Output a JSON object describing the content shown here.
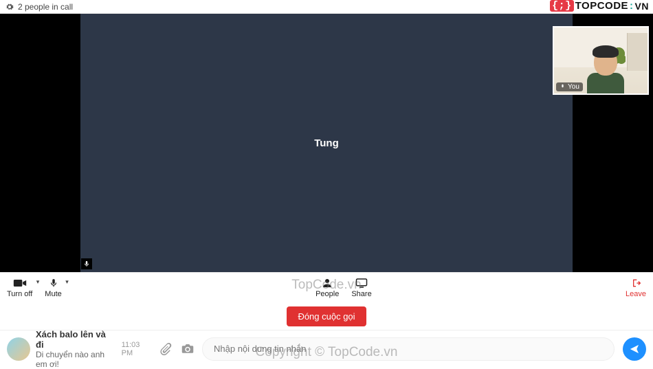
{
  "header": {
    "status": "2 people in call"
  },
  "main_video": {
    "participant_name": "Tung"
  },
  "self_view": {
    "label": "You"
  },
  "controls": {
    "left": [
      {
        "id": "camera",
        "label": "Turn off",
        "chevron": true
      },
      {
        "id": "mic",
        "label": "Mute",
        "chevron": true
      }
    ],
    "center": [
      {
        "id": "people",
        "label": "People"
      },
      {
        "id": "share",
        "label": "Share"
      }
    ],
    "right": [
      {
        "id": "leave",
        "label": "Leave"
      }
    ]
  },
  "end_call": {
    "label": "Đóng cuộc gọi"
  },
  "chat": {
    "last_message": {
      "title": "Xách balo lên và đi",
      "subtitle": "Di chuyển nào anh em ơi!",
      "time": "11:03 PM"
    },
    "input_placeholder": "Nhập nội dung tin nhắn"
  },
  "watermark": {
    "logo_brace": "{;}",
    "logo_text": "TOPCODE",
    "logo_dot": ":",
    "logo_vn": "VN",
    "center": "TopCode.vn",
    "copyright": "Copyright © TopCode.vn"
  }
}
